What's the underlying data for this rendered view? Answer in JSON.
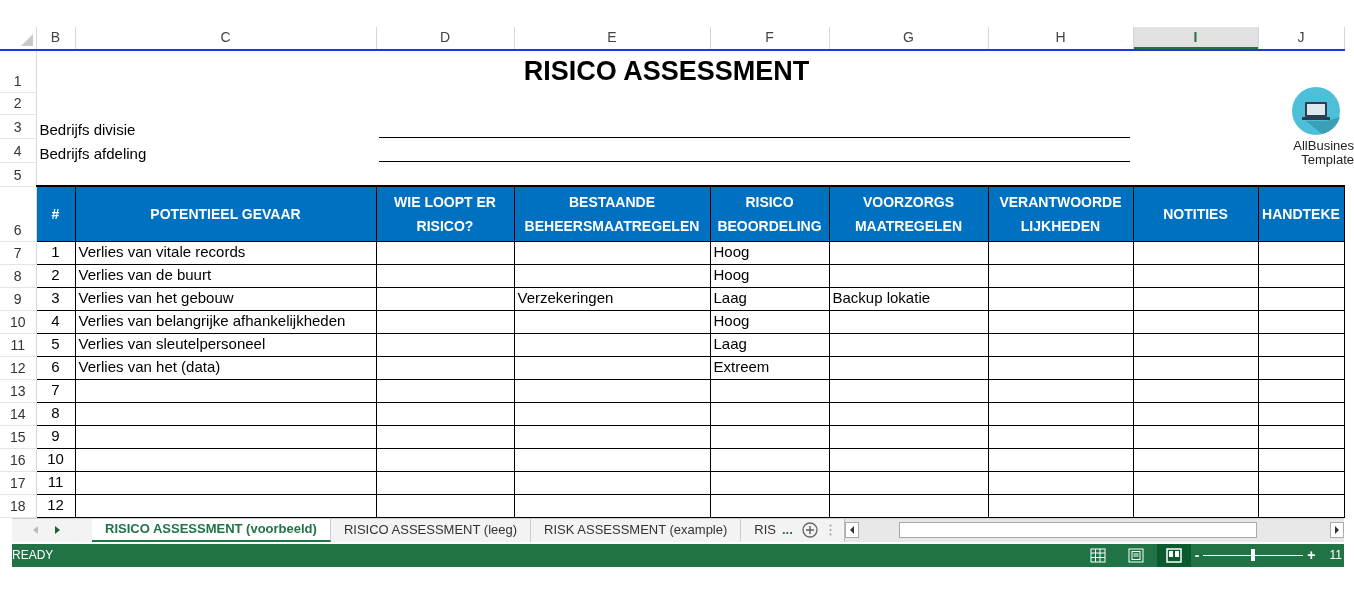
{
  "column_headers": [
    {
      "label": "B",
      "selected": false
    },
    {
      "label": "C",
      "selected": false
    },
    {
      "label": "D",
      "selected": false
    },
    {
      "label": "E",
      "selected": false
    },
    {
      "label": "F",
      "selected": false
    },
    {
      "label": "G",
      "selected": false
    },
    {
      "label": "H",
      "selected": false
    },
    {
      "label": "I",
      "selected": true
    },
    {
      "label": "J",
      "selected": false
    }
  ],
  "row_numbers": [
    "1",
    "2",
    "3",
    "4",
    "5",
    "6",
    "7",
    "8",
    "9",
    "10",
    "11",
    "12",
    "13",
    "14",
    "15",
    "16",
    "17",
    "18"
  ],
  "title": "RISICO ASSESSMENT",
  "fields": [
    {
      "label": "Bedrijfs divisie"
    },
    {
      "label": "Bedrijfs afdeling"
    }
  ],
  "logo": {
    "lines": [
      "AllBusines",
      "Template"
    ]
  },
  "table": {
    "columns": [
      "#",
      "POTENTIEEL GEVAAR",
      "WIE LOOPT ER RISICO?",
      "BESTAANDE BEHEERSMAATREGELEN",
      "RISICO BEOORDELING",
      "VOORZORGS MAATREGELEN",
      "VERANTWOORDE LIJKHEDEN",
      "NOTITIES",
      "HANDTEKE"
    ],
    "rows": [
      {
        "cells": [
          "1",
          "Verlies van vitale records",
          null,
          null,
          "Hoog",
          null,
          null,
          null,
          null
        ]
      },
      {
        "cells": [
          "2",
          "Verlies van de buurt",
          null,
          null,
          "Hoog",
          null,
          null,
          null,
          null
        ]
      },
      {
        "cells": [
          "3",
          "Verlies van het gebouw",
          null,
          "Verzekeringen",
          "Laag",
          "Backup lokatie",
          null,
          null,
          null
        ]
      },
      {
        "cells": [
          "4",
          "Verlies van belangrijke afhankelijkheden",
          null,
          null,
          "Hoog",
          null,
          null,
          null,
          null
        ]
      },
      {
        "cells": [
          "5",
          "Verlies van sleutelpersoneel",
          null,
          null,
          "Laag",
          null,
          null,
          null,
          null
        ]
      },
      {
        "cells": [
          "6",
          "Verlies van het (data)",
          null,
          null,
          "Extreem",
          null,
          null,
          null,
          null
        ]
      },
      {
        "cells": [
          "7",
          null,
          null,
          null,
          null,
          null,
          null,
          null,
          null
        ]
      },
      {
        "cells": [
          "8",
          null,
          null,
          null,
          null,
          null,
          null,
          null,
          null
        ]
      },
      {
        "cells": [
          "9",
          null,
          null,
          null,
          null,
          null,
          null,
          null,
          null
        ]
      },
      {
        "cells": [
          "10",
          null,
          null,
          null,
          null,
          null,
          null,
          null,
          null
        ]
      },
      {
        "cells": [
          "11",
          null,
          null,
          null,
          null,
          null,
          null,
          null,
          null
        ]
      },
      {
        "cells": [
          "12",
          null,
          null,
          null,
          null,
          null,
          null,
          null,
          null
        ]
      }
    ]
  },
  "sheet_tabs": [
    {
      "label": "RISICO ASSESSMENT (voorbeeld)",
      "selected": true
    },
    {
      "label": "RISICO ASSESSMENT (leeg)",
      "selected": false
    },
    {
      "label": "RISK ASSESSMENT (example)",
      "selected": false
    },
    {
      "label": "RIS",
      "selected": false
    }
  ],
  "more_tabs": "...",
  "status_bar": {
    "text": "READY",
    "view_buttons": [
      {
        "kind": "normal",
        "selected": false
      },
      {
        "kind": "layout",
        "selected": false
      },
      {
        "kind": "pagebreak",
        "selected": true
      }
    ],
    "zoom_minus": "-",
    "zoom_plus": "+",
    "zoom": {
      "level": 0.5
    },
    "zoom_value": "11"
  }
}
